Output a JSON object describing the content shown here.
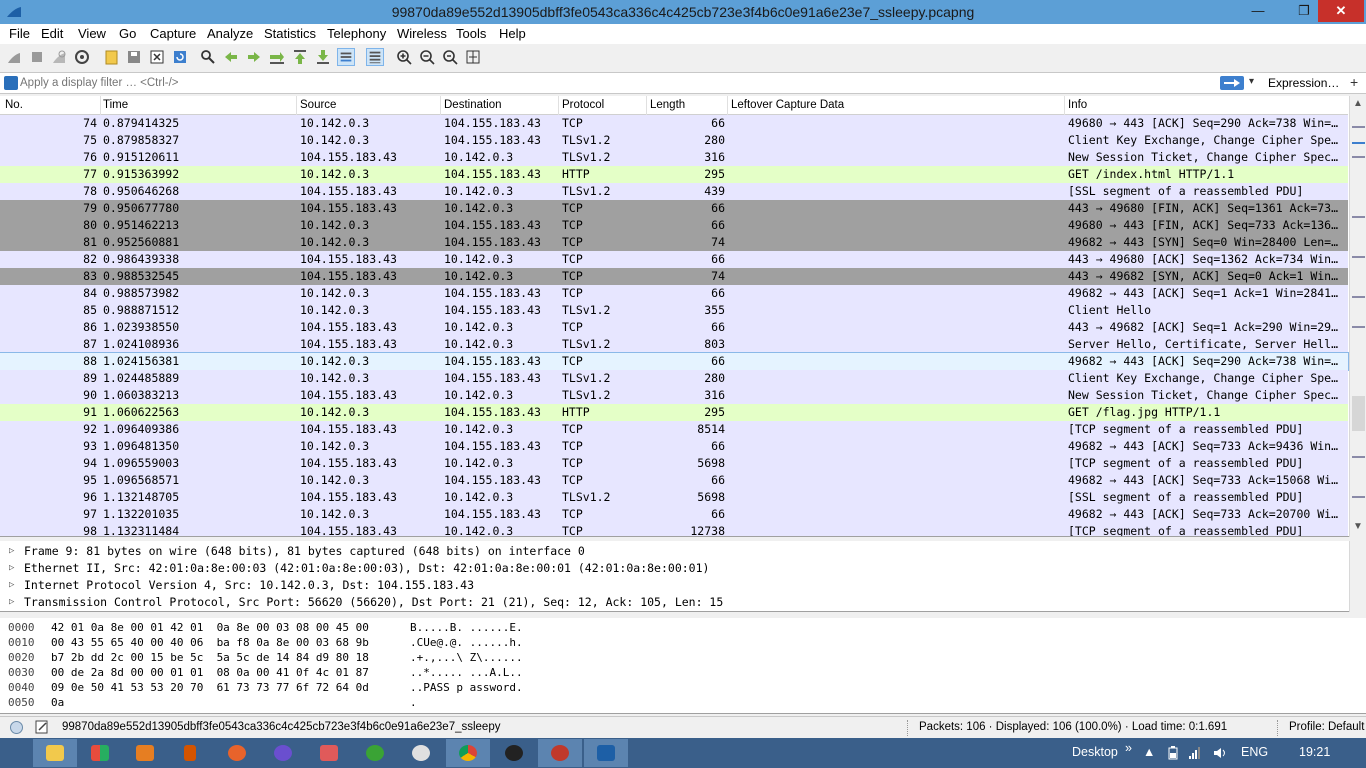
{
  "window": {
    "title": "99870da89e552d13905dbff3fe0543ca336c4c425cb723e3f4b6c0e91a6e23e7_ssleepy.pcapng",
    "minimize": "—",
    "restore": "❐",
    "close": "✕"
  },
  "menu": [
    "File",
    "Edit",
    "View",
    "Go",
    "Capture",
    "Analyze",
    "Statistics",
    "Telephony",
    "Wireless",
    "Tools",
    "Help"
  ],
  "filter": {
    "placeholder": "Apply a display filter … <Ctrl-/>",
    "expression_label": "Expression…",
    "plus": "+",
    "dropdown": "▾"
  },
  "columns": [
    "No.",
    "Time",
    "Source",
    "Destination",
    "Protocol",
    "Length",
    "Leftover Capture Data",
    "Info"
  ],
  "packets": [
    {
      "no": "74",
      "time": "0.879414325",
      "src": "10.142.0.3",
      "dst": "104.155.183.43",
      "proto": "TCP",
      "len": "66",
      "info": "49680 → 443 [ACK] Seq=290 Ack=738 Win=…",
      "style": "tcp"
    },
    {
      "no": "75",
      "time": "0.879858327",
      "src": "10.142.0.3",
      "dst": "104.155.183.43",
      "proto": "TLSv1.2",
      "len": "280",
      "info": "Client Key Exchange, Change Cipher Spe…",
      "style": "tcp"
    },
    {
      "no": "76",
      "time": "0.915120611",
      "src": "104.155.183.43",
      "dst": "10.142.0.3",
      "proto": "TLSv1.2",
      "len": "316",
      "info": "New Session Ticket, Change Cipher Spec…",
      "style": "tcp"
    },
    {
      "no": "77",
      "time": "0.915363992",
      "src": "10.142.0.3",
      "dst": "104.155.183.43",
      "proto": "HTTP",
      "len": "295",
      "info": "GET /index.html HTTP/1.1",
      "style": "http"
    },
    {
      "no": "78",
      "time": "0.950646268",
      "src": "104.155.183.43",
      "dst": "10.142.0.3",
      "proto": "TLSv1.2",
      "len": "439",
      "info": "[SSL segment of a reassembled PDU]",
      "style": "tcp"
    },
    {
      "no": "79",
      "time": "0.950677780",
      "src": "104.155.183.43",
      "dst": "10.142.0.3",
      "proto": "TCP",
      "len": "66",
      "info": "443 → 49680 [FIN, ACK] Seq=1361 Ack=73…",
      "style": "gray"
    },
    {
      "no": "80",
      "time": "0.951462213",
      "src": "10.142.0.3",
      "dst": "104.155.183.43",
      "proto": "TCP",
      "len": "66",
      "info": "49680 → 443 [FIN, ACK] Seq=733 Ack=136…",
      "style": "gray"
    },
    {
      "no": "81",
      "time": "0.952560881",
      "src": "10.142.0.3",
      "dst": "104.155.183.43",
      "proto": "TCP",
      "len": "74",
      "info": "49682 → 443 [SYN] Seq=0 Win=28400 Len=…",
      "style": "gray"
    },
    {
      "no": "82",
      "time": "0.986439338",
      "src": "104.155.183.43",
      "dst": "10.142.0.3",
      "proto": "TCP",
      "len": "66",
      "info": "443 → 49680 [ACK] Seq=1362 Ack=734 Win…",
      "style": "tcp"
    },
    {
      "no": "83",
      "time": "0.988532545",
      "src": "104.155.183.43",
      "dst": "10.142.0.3",
      "proto": "TCP",
      "len": "74",
      "info": "443 → 49682 [SYN, ACK] Seq=0 Ack=1 Win…",
      "style": "gray"
    },
    {
      "no": "84",
      "time": "0.988573982",
      "src": "10.142.0.3",
      "dst": "104.155.183.43",
      "proto": "TCP",
      "len": "66",
      "info": "49682 → 443 [ACK] Seq=1 Ack=1 Win=2841…",
      "style": "tcp"
    },
    {
      "no": "85",
      "time": "0.988871512",
      "src": "10.142.0.3",
      "dst": "104.155.183.43",
      "proto": "TLSv1.2",
      "len": "355",
      "info": "Client Hello",
      "style": "tcp"
    },
    {
      "no": "86",
      "time": "1.023938550",
      "src": "104.155.183.43",
      "dst": "10.142.0.3",
      "proto": "TCP",
      "len": "66",
      "info": "443 → 49682 [ACK] Seq=1 Ack=290 Win=29…",
      "style": "tcp"
    },
    {
      "no": "87",
      "time": "1.024108936",
      "src": "104.155.183.43",
      "dst": "10.142.0.3",
      "proto": "TLSv1.2",
      "len": "803",
      "info": "Server Hello, Certificate, Server Hell…",
      "style": "tcp"
    },
    {
      "no": "88",
      "time": "1.024156381",
      "src": "10.142.0.3",
      "dst": "104.155.183.43",
      "proto": "TCP",
      "len": "66",
      "info": "49682 → 443 [ACK] Seq=290 Ack=738 Win=…",
      "style": "hover"
    },
    {
      "no": "89",
      "time": "1.024485889",
      "src": "10.142.0.3",
      "dst": "104.155.183.43",
      "proto": "TLSv1.2",
      "len": "280",
      "info": "Client Key Exchange, Change Cipher Spe…",
      "style": "tcp"
    },
    {
      "no": "90",
      "time": "1.060383213",
      "src": "104.155.183.43",
      "dst": "10.142.0.3",
      "proto": "TLSv1.2",
      "len": "316",
      "info": "New Session Ticket, Change Cipher Spec…",
      "style": "tcp"
    },
    {
      "no": "91",
      "time": "1.060622563",
      "src": "10.142.0.3",
      "dst": "104.155.183.43",
      "proto": "HTTP",
      "len": "295",
      "info": "GET /flag.jpg HTTP/1.1",
      "style": "http"
    },
    {
      "no": "92",
      "time": "1.096409386",
      "src": "104.155.183.43",
      "dst": "10.142.0.3",
      "proto": "TCP",
      "len": "8514",
      "info": "[TCP segment of a reassembled PDU]",
      "style": "tcp"
    },
    {
      "no": "93",
      "time": "1.096481350",
      "src": "10.142.0.3",
      "dst": "104.155.183.43",
      "proto": "TCP",
      "len": "66",
      "info": "49682 → 443 [ACK] Seq=733 Ack=9436 Win…",
      "style": "tcp"
    },
    {
      "no": "94",
      "time": "1.096559003",
      "src": "104.155.183.43",
      "dst": "10.142.0.3",
      "proto": "TCP",
      "len": "5698",
      "info": "[TCP segment of a reassembled PDU]",
      "style": "tcp"
    },
    {
      "no": "95",
      "time": "1.096568571",
      "src": "10.142.0.3",
      "dst": "104.155.183.43",
      "proto": "TCP",
      "len": "66",
      "info": "49682 → 443 [ACK] Seq=733 Ack=15068 Wi…",
      "style": "tcp"
    },
    {
      "no": "96",
      "time": "1.132148705",
      "src": "104.155.183.43",
      "dst": "10.142.0.3",
      "proto": "TLSv1.2",
      "len": "5698",
      "info": "[SSL segment of a reassembled PDU]",
      "style": "tcp"
    },
    {
      "no": "97",
      "time": "1.132201035",
      "src": "10.142.0.3",
      "dst": "104.155.183.43",
      "proto": "TCP",
      "len": "66",
      "info": "49682 → 443 [ACK] Seq=733 Ack=20700 Wi…",
      "style": "tcp"
    },
    {
      "no": "98",
      "time": "1.132311484",
      "src": "104.155.183.43",
      "dst": "10.142.0.3",
      "proto": "TCP",
      "len": "12738",
      "info": "[TCP segment of a reassembled PDU]",
      "style": "tcp"
    }
  ],
  "row_colors": {
    "tcp": "#e7e6ff",
    "http": "#e4ffc7",
    "gray": "#a0a0a0",
    "hover": "#e5f3ff"
  },
  "details": [
    "Frame 9: 81 bytes on wire (648 bits), 81 bytes captured (648 bits) on interface 0",
    "Ethernet II, Src: 42:01:0a:8e:00:03 (42:01:0a:8e:00:03), Dst: 42:01:0a:8e:00:01 (42:01:0a:8e:00:01)",
    "Internet Protocol Version 4, Src: 10.142.0.3, Dst: 104.155.183.43",
    "Transmission Control Protocol, Src Port: 56620 (56620), Dst Port: 21 (21), Seq: 12, Ack: 105, Len: 15"
  ],
  "hex": [
    {
      "off": "0000",
      "hex": "42 01 0a 8e 00 01 42 01  0a 8e 00 03 08 00 45 00",
      "ascii": "B.....B. ......E."
    },
    {
      "off": "0010",
      "hex": "00 43 55 65 40 00 40 06  ba f8 0a 8e 00 03 68 9b",
      "ascii": ".CUe@.@. ......h."
    },
    {
      "off": "0020",
      "hex": "b7 2b dd 2c 00 15 be 5c  5a 5c de 14 84 d9 80 18",
      "ascii": ".+.,...\\ Z\\......"
    },
    {
      "off": "0030",
      "hex": "00 de 2a 8d 00 00 01 01  08 0a 00 41 0f 4c 01 87",
      "ascii": "..*..... ...A.L.."
    },
    {
      "off": "0040",
      "hex": "09 0e 50 41 53 53 20 70  61 73 73 77 6f 72 64 0d",
      "ascii": "..PASS p assword."
    },
    {
      "off": "0050",
      "hex": "0a",
      "ascii": "."
    }
  ],
  "status": {
    "file": "99870da89e552d13905dbff3fe0543ca336c4c425cb723e3f4b6c0e91a6e23e7_ssleepy",
    "packets": "Packets: 106 · Displayed: 106 (100.0%) · Load time: 0:1.691",
    "profile": "Profile: Default"
  },
  "taskbar": {
    "desktop": "Desktop",
    "chevron": "»",
    "lang": "ENG",
    "time": "19:21",
    "apps": [
      "file-explorer",
      "store",
      "office",
      "notebook",
      "firefox",
      "firefox-dev",
      "camera",
      "utorrent",
      "anonymous",
      "chrome",
      "hacker",
      "burp",
      "wireshark"
    ]
  }
}
